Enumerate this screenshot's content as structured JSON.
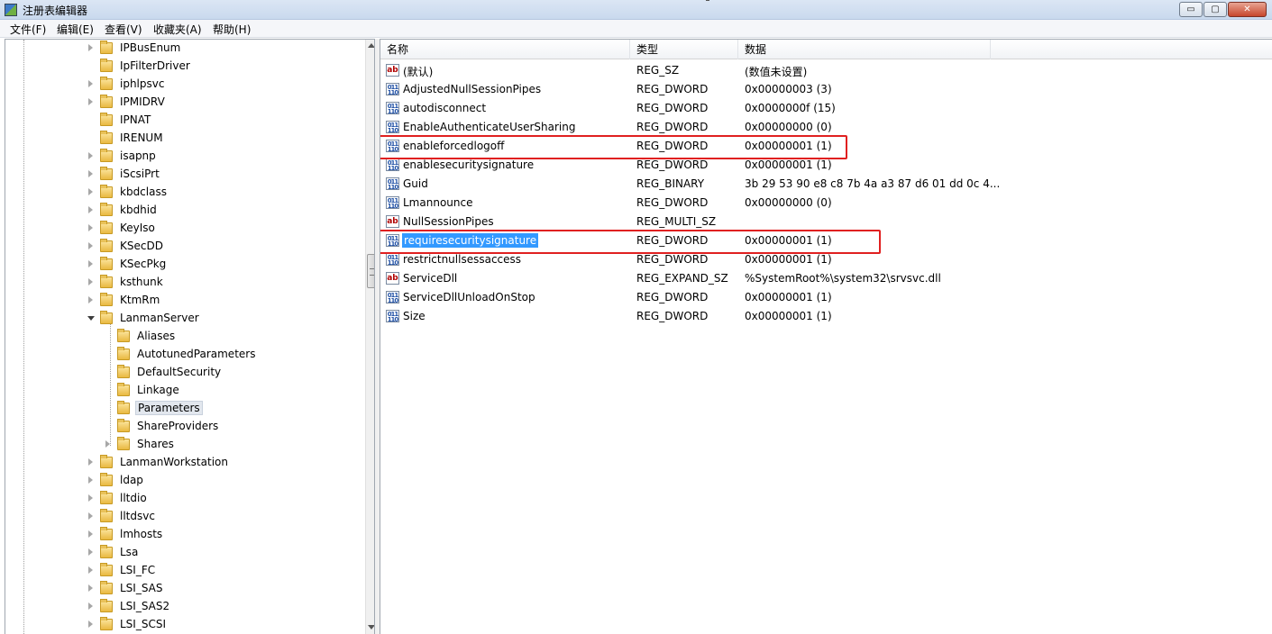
{
  "window": {
    "title": "注册表编辑器",
    "minimize_glyph": "▭",
    "maximize_glyph": "▢",
    "close_glyph": "✕",
    "icon": "regedit-icon"
  },
  "menu": [
    "文件(F)",
    "编辑(E)",
    "查看(V)",
    "收藏夹(A)",
    "帮助(H)"
  ],
  "tree": {
    "items": [
      {
        "label": "IPBusEnum",
        "level": 1,
        "expander": "collapsed"
      },
      {
        "label": "IpFilterDriver",
        "level": 1,
        "expander": "none"
      },
      {
        "label": "iphlpsvc",
        "level": 1,
        "expander": "collapsed"
      },
      {
        "label": "IPMIDRV",
        "level": 1,
        "expander": "collapsed"
      },
      {
        "label": "IPNAT",
        "level": 1,
        "expander": "none"
      },
      {
        "label": "IRENUM",
        "level": 1,
        "expander": "none"
      },
      {
        "label": "isapnp",
        "level": 1,
        "expander": "collapsed"
      },
      {
        "label": "iScsiPrt",
        "level": 1,
        "expander": "collapsed"
      },
      {
        "label": "kbdclass",
        "level": 1,
        "expander": "collapsed"
      },
      {
        "label": "kbdhid",
        "level": 1,
        "expander": "collapsed"
      },
      {
        "label": "KeyIso",
        "level": 1,
        "expander": "collapsed"
      },
      {
        "label": "KSecDD",
        "level": 1,
        "expander": "collapsed"
      },
      {
        "label": "KSecPkg",
        "level": 1,
        "expander": "collapsed"
      },
      {
        "label": "ksthunk",
        "level": 1,
        "expander": "collapsed"
      },
      {
        "label": "KtmRm",
        "level": 1,
        "expander": "collapsed"
      },
      {
        "label": "LanmanServer",
        "level": 1,
        "expander": "expanded"
      },
      {
        "label": "Aliases",
        "level": 2,
        "expander": "none"
      },
      {
        "label": "AutotunedParameters",
        "level": 2,
        "expander": "none"
      },
      {
        "label": "DefaultSecurity",
        "level": 2,
        "expander": "none"
      },
      {
        "label": "Linkage",
        "level": 2,
        "expander": "none"
      },
      {
        "label": "Parameters",
        "level": 2,
        "expander": "none",
        "selected": true
      },
      {
        "label": "ShareProviders",
        "level": 2,
        "expander": "none"
      },
      {
        "label": "Shares",
        "level": 2,
        "expander": "collapsed"
      },
      {
        "label": "LanmanWorkstation",
        "level": 1,
        "expander": "collapsed"
      },
      {
        "label": "ldap",
        "level": 1,
        "expander": "collapsed"
      },
      {
        "label": "lltdio",
        "level": 1,
        "expander": "collapsed"
      },
      {
        "label": "lltdsvc",
        "level": 1,
        "expander": "collapsed"
      },
      {
        "label": "lmhosts",
        "level": 1,
        "expander": "collapsed"
      },
      {
        "label": "Lsa",
        "level": 1,
        "expander": "collapsed"
      },
      {
        "label": "LSI_FC",
        "level": 1,
        "expander": "collapsed"
      },
      {
        "label": "LSI_SAS",
        "level": 1,
        "expander": "collapsed"
      },
      {
        "label": "LSI_SAS2",
        "level": 1,
        "expander": "collapsed"
      },
      {
        "label": "LSI_SCSI",
        "level": 1,
        "expander": "collapsed"
      }
    ]
  },
  "list": {
    "columns": [
      "名称",
      "类型",
      "数据"
    ],
    "rows": [
      {
        "name": "(默认)",
        "type": "REG_SZ",
        "data": "(数值未设置)",
        "icon": "string-value-icon"
      },
      {
        "name": "AdjustedNullSessionPipes",
        "type": "REG_DWORD",
        "data": "0x00000003 (3)",
        "icon": "binary-value-icon"
      },
      {
        "name": "autodisconnect",
        "type": "REG_DWORD",
        "data": "0x0000000f (15)",
        "icon": "binary-value-icon"
      },
      {
        "name": "EnableAuthenticateUserSharing",
        "type": "REG_DWORD",
        "data": "0x00000000 (0)",
        "icon": "binary-value-icon"
      },
      {
        "name": "enableforcedlogoff",
        "type": "REG_DWORD",
        "data": "0x00000001 (1)",
        "icon": "binary-value-icon",
        "highlighted": true
      },
      {
        "name": "enablesecuritysignature",
        "type": "REG_DWORD",
        "data": "0x00000001 (1)",
        "icon": "binary-value-icon"
      },
      {
        "name": "Guid",
        "type": "REG_BINARY",
        "data": "3b 29 53 90 e8 c8 7b 4a a3 87 d6 01 dd 0c 4...",
        "icon": "binary-value-icon"
      },
      {
        "name": "Lmannounce",
        "type": "REG_DWORD",
        "data": "0x00000000 (0)",
        "icon": "binary-value-icon"
      },
      {
        "name": "NullSessionPipes",
        "type": "REG_MULTI_SZ",
        "data": "",
        "icon": "string-value-icon"
      },
      {
        "name": "requiresecuritysignature",
        "type": "REG_DWORD",
        "data": "0x00000001 (1)",
        "icon": "binary-value-icon",
        "selected": true,
        "highlighted": true
      },
      {
        "name": "restrictnullsessaccess",
        "type": "REG_DWORD",
        "data": "0x00000001 (1)",
        "icon": "binary-value-icon"
      },
      {
        "name": "ServiceDll",
        "type": "REG_EXPAND_SZ",
        "data": "%SystemRoot%\\system32\\srvsvc.dll",
        "icon": "string-value-icon"
      },
      {
        "name": "ServiceDllUnloadOnStop",
        "type": "REG_DWORD",
        "data": "0x00000001 (1)",
        "icon": "binary-value-icon"
      },
      {
        "name": "Size",
        "type": "REG_DWORD",
        "data": "0x00000001 (1)",
        "icon": "binary-value-icon"
      }
    ]
  },
  "colors": {
    "selection": "#3399ff",
    "highlight_border": "#e02020"
  }
}
